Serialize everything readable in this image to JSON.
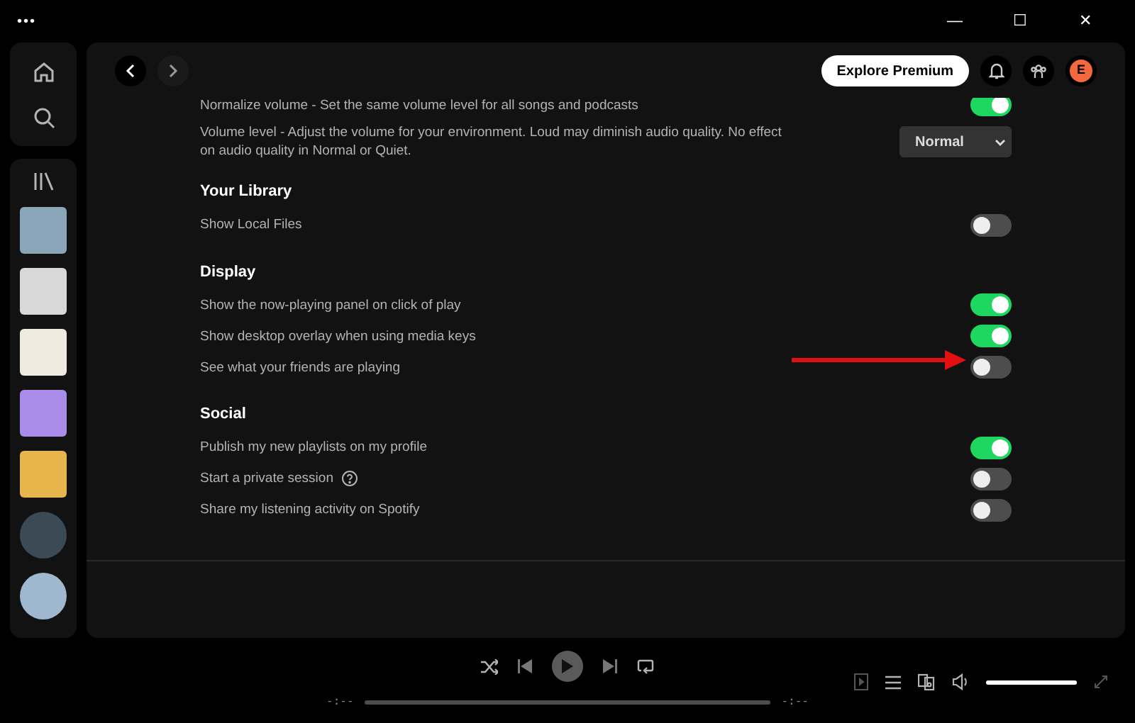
{
  "title_bar": {
    "menu": "•••",
    "controls": [
      "—",
      "☐",
      "✕"
    ]
  },
  "sidebar": {
    "items": [
      {
        "kind": "playlist"
      },
      {
        "kind": "album"
      },
      {
        "kind": "album"
      },
      {
        "kind": "playlist"
      },
      {
        "kind": "playlist"
      },
      {
        "kind": "artist"
      },
      {
        "kind": "artist"
      }
    ]
  },
  "header": {
    "premium_button": "Explore Premium",
    "avatar": "E"
  },
  "settings": [
    {
      "rows": [
        {
          "kind": "toggle",
          "label": "Normalize volume - Set the same volume level for all songs and podcasts",
          "on": true
        },
        {
          "kind": "dropdown",
          "label": "Volume level - Adjust the volume for your environment. Loud may diminish audio quality. No effect on audio quality in Normal or Quiet.",
          "value": "Normal"
        }
      ]
    },
    {
      "heading": "Your Library",
      "rows": [
        {
          "kind": "toggle",
          "label": "Show Local Files",
          "on": false
        }
      ]
    },
    {
      "heading": "Display",
      "rows": [
        {
          "kind": "toggle",
          "label": "Show the now-playing panel on click of play",
          "on": true
        },
        {
          "kind": "toggle",
          "label": "Show desktop overlay when using media keys",
          "on": true
        },
        {
          "kind": "toggle",
          "label": "See what your friends are playing",
          "on": false,
          "pointed": true
        }
      ]
    },
    {
      "heading": "Social",
      "rows": [
        {
          "kind": "toggle",
          "label": "Publish my new playlists on my profile",
          "on": true
        },
        {
          "kind": "toggle",
          "label": "Start a private session",
          "on": false,
          "help": true
        },
        {
          "kind": "toggle",
          "label": "Share my listening activity on Spotify",
          "on": false
        }
      ]
    }
  ],
  "player": {
    "elapsed": "-:--",
    "duration": "-:--",
    "volume": {
      "level": 1
    }
  }
}
